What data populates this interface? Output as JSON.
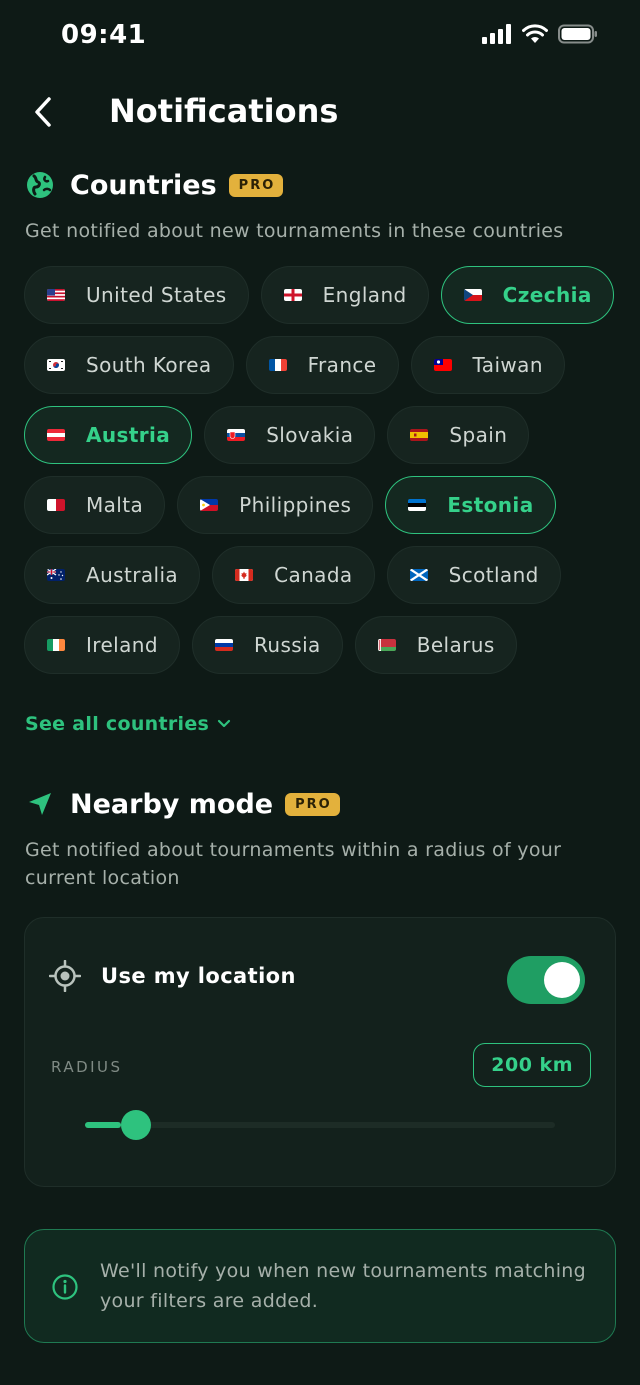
{
  "status_bar": {
    "time": "09:41"
  },
  "header": {
    "title": "Notifications"
  },
  "countries": {
    "title": "Countries",
    "badge": "PRO",
    "description": "Get notified about new tournaments in these countries",
    "items": [
      {
        "label": "United States",
        "flag": "us",
        "selected": false
      },
      {
        "label": "England",
        "flag": "en",
        "selected": false
      },
      {
        "label": "Czechia",
        "flag": "cz",
        "selected": true
      },
      {
        "label": "South Korea",
        "flag": "kr",
        "selected": false
      },
      {
        "label": "France",
        "flag": "fr",
        "selected": false
      },
      {
        "label": "Taiwan",
        "flag": "tw",
        "selected": false
      },
      {
        "label": "Austria",
        "flag": "at",
        "selected": true
      },
      {
        "label": "Slovakia",
        "flag": "sk",
        "selected": false
      },
      {
        "label": "Spain",
        "flag": "es",
        "selected": false
      },
      {
        "label": "Malta",
        "flag": "mt",
        "selected": false
      },
      {
        "label": "Philippines",
        "flag": "ph",
        "selected": false
      },
      {
        "label": "Estonia",
        "flag": "ee",
        "selected": true
      },
      {
        "label": "Australia",
        "flag": "au",
        "selected": false
      },
      {
        "label": "Canada",
        "flag": "ca",
        "selected": false
      },
      {
        "label": "Scotland",
        "flag": "sc",
        "selected": false
      },
      {
        "label": "Ireland",
        "flag": "ie",
        "selected": false
      },
      {
        "label": "Russia",
        "flag": "ru",
        "selected": false
      },
      {
        "label": "Belarus",
        "flag": "by",
        "selected": false
      }
    ],
    "see_all": "See all countries"
  },
  "nearby": {
    "title": "Nearby mode",
    "badge": "PRO",
    "description_line1": "Get notified about tournaments within a radius of your",
    "description_line2": "current location",
    "use_location_label": "Use my location",
    "use_location_on": true,
    "radius_label": "RADIUS",
    "radius_value": "200 km",
    "slider_fraction": 0.055
  },
  "info": {
    "line1": "We'll notify you when new tournaments matching",
    "line2": "your filters are added."
  },
  "colors": {
    "background": "#0e1a16",
    "accent": "#2ec27e",
    "pro_badge": "#e3b13c"
  }
}
